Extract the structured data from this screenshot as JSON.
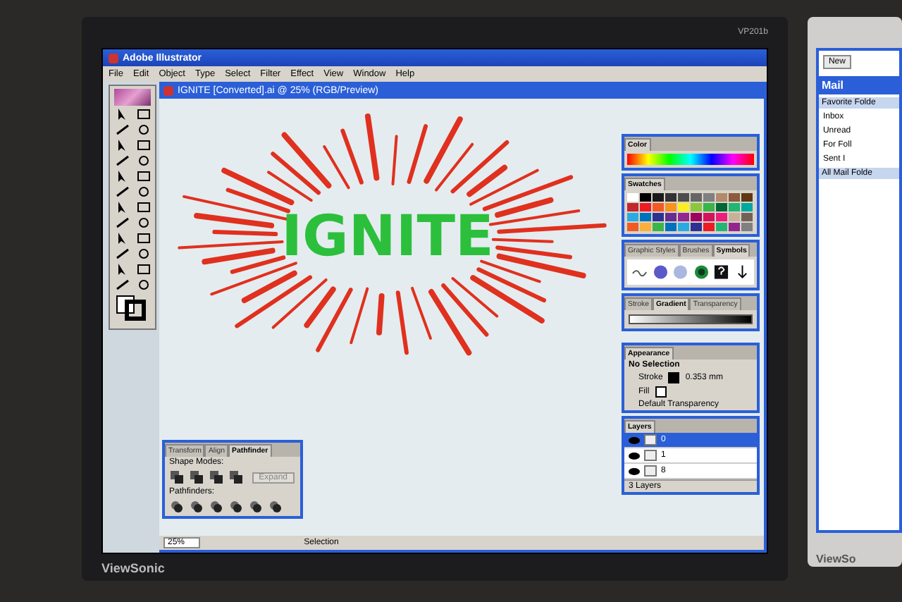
{
  "monitor": {
    "model": "VP201b",
    "brand": "ViewSonic"
  },
  "app": {
    "title": "Adobe Illustrator",
    "menu": [
      "File",
      "Edit",
      "Object",
      "Type",
      "Select",
      "Filter",
      "Effect",
      "View",
      "Window",
      "Help"
    ]
  },
  "document": {
    "title": "IGNITE [Converted].ai @ 25% (RGB/Preview)",
    "artwork_text": "IGNITE"
  },
  "color_panel": {
    "tabs": [
      {
        "label": "Color",
        "selected": true
      }
    ]
  },
  "swatches_panel": {
    "tabs": [
      {
        "label": "Swatches",
        "selected": true
      }
    ],
    "swatches": [
      {
        "color": "#ffffff"
      },
      {
        "color": "#000000"
      },
      {
        "color": "#1a1a1a"
      },
      {
        "color": "#333333"
      },
      {
        "color": "#4d4d4d"
      },
      {
        "color": "#666666"
      },
      {
        "color": "#808080"
      },
      {
        "color": "#b38a6a"
      },
      {
        "color": "#8c5a3c"
      },
      {
        "color": "#603813"
      },
      {
        "color": "#c1272d"
      },
      {
        "color": "#ed1c24"
      },
      {
        "color": "#f15a24"
      },
      {
        "color": "#f7931e"
      },
      {
        "color": "#fcee21"
      },
      {
        "color": "#8cc63f"
      },
      {
        "color": "#39b54a"
      },
      {
        "color": "#006837"
      },
      {
        "color": "#22b573"
      },
      {
        "color": "#00a99d"
      },
      {
        "color": "#29abe2"
      },
      {
        "color": "#0071bc"
      },
      {
        "color": "#2e3192"
      },
      {
        "color": "#662d91"
      },
      {
        "color": "#93278f"
      },
      {
        "color": "#9e005d"
      },
      {
        "color": "#d4145a"
      },
      {
        "color": "#ed1e79"
      },
      {
        "color": "#c7b299"
      },
      {
        "color": "#736357"
      },
      {
        "color": "#f15a24"
      },
      {
        "color": "#fbb03b"
      },
      {
        "color": "#39b54a"
      },
      {
        "color": "#0071bc"
      },
      {
        "color": "#29abe2"
      },
      {
        "color": "#2e3192"
      },
      {
        "color": "#ed1c24"
      },
      {
        "color": "#22b573"
      },
      {
        "color": "#93278f"
      },
      {
        "color": "#808080"
      }
    ]
  },
  "symbols_panel": {
    "tabs": [
      {
        "label": "Graphic Styles",
        "selected": false
      },
      {
        "label": "Brushes",
        "selected": false
      },
      {
        "label": "Symbols",
        "selected": true
      }
    ]
  },
  "gradient_panel": {
    "tabs": [
      {
        "label": "Stroke",
        "selected": false
      },
      {
        "label": "Gradient",
        "selected": true
      },
      {
        "label": "Transparency",
        "selected": false
      }
    ]
  },
  "appearance_panel": {
    "tabs": [
      {
        "label": "Appearance",
        "selected": true
      }
    ],
    "heading": "No Selection",
    "rows": [
      {
        "kind": "stroke",
        "label": "Stroke",
        "value": "0.353 mm"
      },
      {
        "kind": "fill",
        "label": "Fill"
      }
    ],
    "footer": "Default Transparency"
  },
  "layers_panel": {
    "tabs": [
      {
        "label": "Layers",
        "selected": true
      }
    ],
    "layers": [
      {
        "name": "0",
        "selected": true
      },
      {
        "name": "1",
        "selected": false
      },
      {
        "name": "8",
        "selected": false
      }
    ],
    "status": "3 Layers"
  },
  "pathfinder_panel": {
    "tabs": [
      {
        "label": "Transform",
        "selected": false
      },
      {
        "label": "Align",
        "selected": false
      },
      {
        "label": "Pathfinder",
        "selected": true
      }
    ],
    "shape_modes_label": "Shape Modes:",
    "expand_button": "Expand",
    "pathfinders_label": "Pathfinders:"
  },
  "status_bar": {
    "zoom": "25%",
    "tool": "Selection"
  },
  "second_monitor": {
    "new_button": "New",
    "section_title": "Mail",
    "favorites_header": "Favorite Folde",
    "folders": [
      "Inbox",
      "Unread",
      "For Foll",
      "Sent I"
    ],
    "all_header": "All Mail Folde",
    "brand": "ViewSo"
  }
}
